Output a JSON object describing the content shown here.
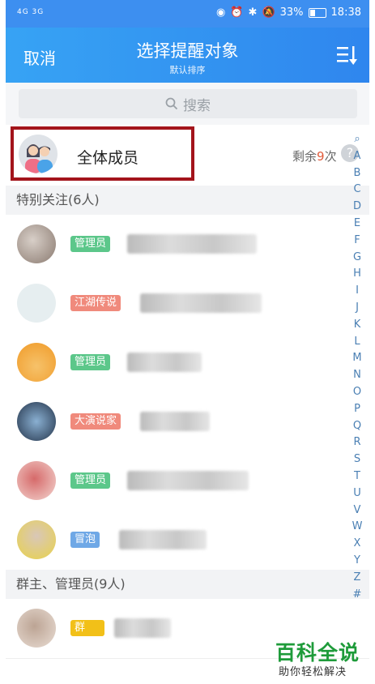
{
  "status_bar": {
    "signal_left": "4G 3G",
    "battery_percent": "33%",
    "time": "18:38"
  },
  "header": {
    "cancel_label": "取消",
    "title": "选择提醒对象",
    "subtitle": "默认排序"
  },
  "search": {
    "placeholder": "搜索"
  },
  "all_members": {
    "label": "全体成员",
    "remain_prefix": "剩余",
    "remain_count": "9",
    "remain_suffix": "次",
    "help": "?"
  },
  "sections": [
    {
      "title": "特别关注(6人)"
    },
    {
      "title": "群主、管理员(9人)"
    }
  ],
  "members": [
    {
      "badge": "管理员",
      "badge_color": "#5cc78a",
      "avatar_color": "#b9a89b"
    },
    {
      "badge": "江湖传说",
      "badge_color": "#f08a7c",
      "avatar_color": "#e6eef0"
    },
    {
      "badge": "管理员",
      "badge_color": "#5cc78a",
      "avatar_color": "#f3a43b"
    },
    {
      "badge": "大演说家",
      "badge_color": "#f08a7c",
      "avatar_color": "#3e5672"
    },
    {
      "badge": "管理员",
      "badge_color": "#5cc78a",
      "avatar_color": "#e8b4b0"
    },
    {
      "badge": "冒泡",
      "badge_color": "#6fa8e6",
      "avatar_color": "#b8a58a"
    },
    {
      "badge": "群",
      "badge_color": "#f2c018",
      "avatar_color": "#c7b2a6"
    }
  ],
  "alphabet": [
    "A",
    "B",
    "C",
    "D",
    "E",
    "F",
    "G",
    "H",
    "I",
    "J",
    "K",
    "L",
    "M",
    "N",
    "O",
    "P",
    "Q",
    "R",
    "S",
    "T",
    "U",
    "V",
    "W",
    "X",
    "Y",
    "Z",
    "#"
  ],
  "watermark": {
    "title": "百科全说",
    "subtitle": "助你轻松解决"
  }
}
